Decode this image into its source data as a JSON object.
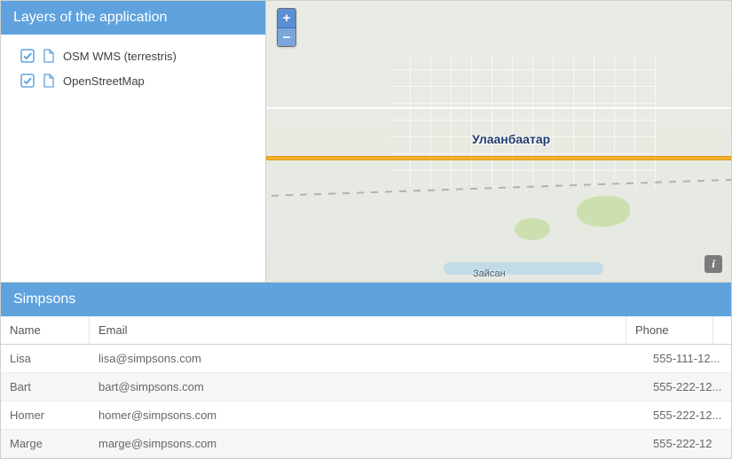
{
  "layers_panel": {
    "title": "Layers of the application",
    "items": [
      {
        "label": "OSM WMS (terrestris)",
        "checked": true
      },
      {
        "label": "OpenStreetMap",
        "checked": true
      }
    ]
  },
  "map": {
    "zoom_in_label": "+",
    "zoom_out_label": "−",
    "info_label": "i",
    "city_label": "Улаанбаатар",
    "sub_label": "Зайсан"
  },
  "grid": {
    "title": "Simpsons",
    "columns": {
      "name": "Name",
      "email": "Email",
      "phone": "Phone"
    },
    "rows": [
      {
        "name": "Lisa",
        "email": "lisa@simpsons.com",
        "phone": "555-111-12..."
      },
      {
        "name": "Bart",
        "email": "bart@simpsons.com",
        "phone": "555-222-12..."
      },
      {
        "name": "Homer",
        "email": "homer@simpsons.com",
        "phone": "555-222-12..."
      },
      {
        "name": "Marge",
        "email": "marge@simpsons.com",
        "phone": "555-222-12"
      }
    ]
  }
}
